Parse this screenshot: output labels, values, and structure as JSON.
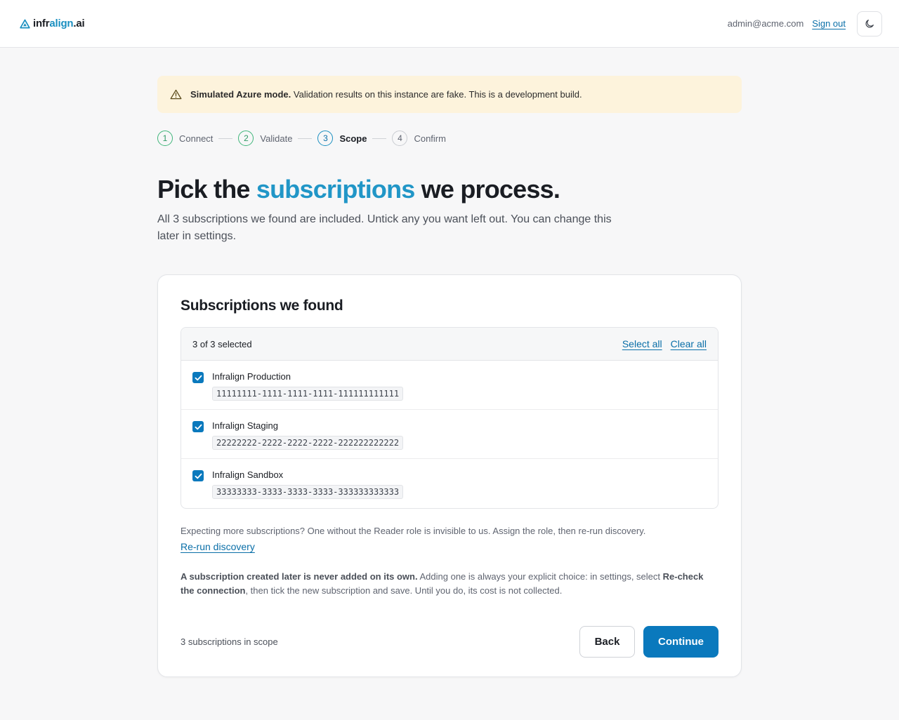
{
  "header": {
    "logo": {
      "part1": "infr",
      "part2": "align",
      "part3": ".ai"
    },
    "user_email": "admin@acme.com",
    "signout_label": "Sign out"
  },
  "alert": {
    "strong": "Simulated Azure mode.",
    "text": " Validation results on this instance are fake. This is a development build."
  },
  "stepper": [
    {
      "num": "1",
      "label": "Connect",
      "state": "done"
    },
    {
      "num": "2",
      "label": "Validate",
      "state": "done"
    },
    {
      "num": "3",
      "label": "Scope",
      "state": "active"
    },
    {
      "num": "4",
      "label": "Confirm",
      "state": "pending"
    }
  ],
  "page": {
    "title_before": "Pick the ",
    "title_accent": "subscriptions",
    "title_after": " we process.",
    "subtitle": "All 3 subscriptions we found are included. Untick any you want left out. You can change this later in settings."
  },
  "card": {
    "title": "Subscriptions we found",
    "selected_count": "3 of 3 selected",
    "select_all": "Select all",
    "clear_all": "Clear all",
    "subscriptions": [
      {
        "name": "Infralign Production",
        "id": "11111111-1111-1111-1111-111111111111",
        "checked": true
      },
      {
        "name": "Infralign Staging",
        "id": "22222222-2222-2222-2222-222222222222",
        "checked": true
      },
      {
        "name": "Infralign Sandbox",
        "id": "33333333-3333-3333-3333-333333333333",
        "checked": true
      }
    ],
    "note": "Expecting more subscriptions? One without the Reader role is invisible to us. Assign the role, then re-run discovery.",
    "rerun_label": "Re-run discovery",
    "note2_strong1": "A subscription created later is never added on its own.",
    "note2_text1": " Adding one is always your explicit choice: in settings, select ",
    "note2_strong2": "Re-check the connection",
    "note2_text2": ", then tick the new subscription and save. Until you do, its cost is not collected.",
    "scope_count": "3 subscriptions in scope",
    "back_label": "Back",
    "continue_label": "Continue"
  },
  "colors": {
    "accent": "#2196c7",
    "primary": "#0a79bd",
    "alert_bg": "#fdf3dc",
    "done": "#3fb57a"
  }
}
